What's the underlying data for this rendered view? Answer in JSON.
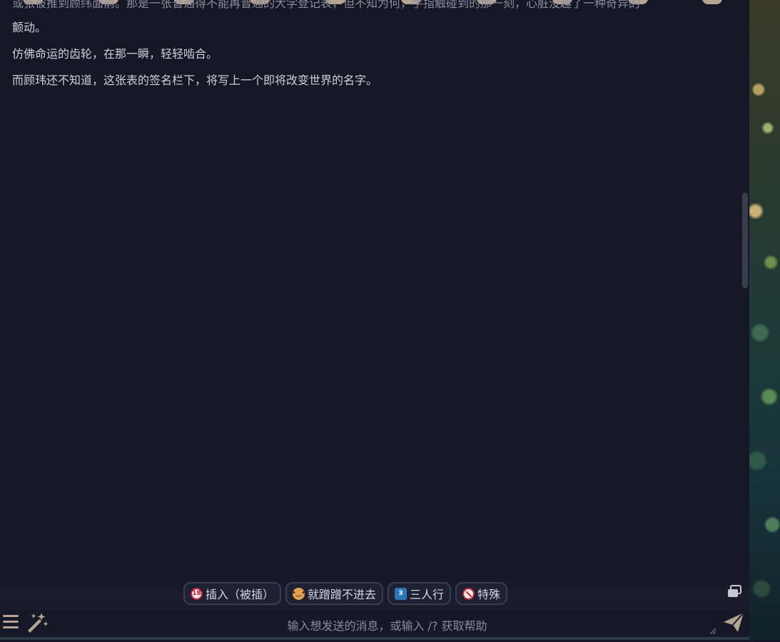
{
  "message": {
    "cut_line": "或张被推到顾纬面前。那是一张普通得不能再普通的大学登记表，但不知为何，手指触碰到的那一刻，心脏没趣了一种奇异的",
    "paragraphs": [
      "颤动。",
      "仿佛命运的齿轮，在那一瞬，轻轻啮合。",
      "而顾玮还不知道，这张表的签名栏下，将写上一个即将改变世界的名字。"
    ]
  },
  "quick_replies": [
    {
      "label": "插入（被插）",
      "icon": "18-plus-icon"
    },
    {
      "label": "就蹭蹭不进去",
      "icon": "face-icon"
    },
    {
      "label": "三人行",
      "icon": "keycap-3-icon"
    },
    {
      "label": "特殊",
      "icon": "prohibited-icon"
    }
  ],
  "input": {
    "placeholder": "输入想发送的消息，或输入 /? 获取帮助"
  },
  "colors": {
    "background": "#151626",
    "accent": "#b3a493",
    "text": "#cfd0d8"
  }
}
